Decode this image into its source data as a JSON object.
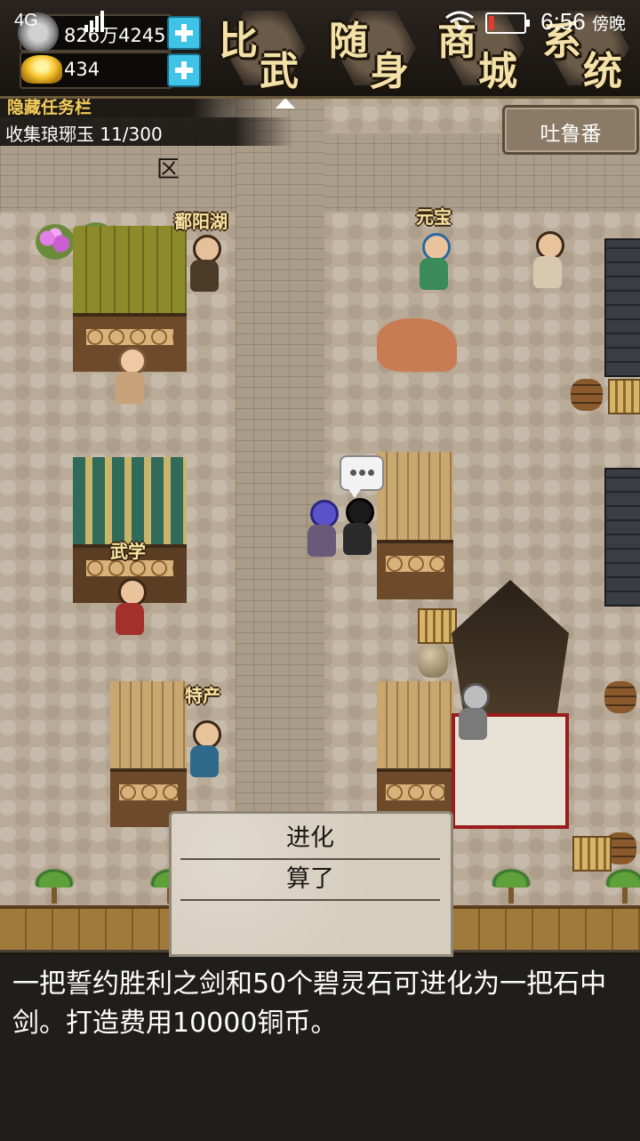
{
  "status_bar": {
    "network": "4G",
    "time": "6:56",
    "period": "傍晚"
  },
  "resources": {
    "copper": "826万4245",
    "ingot": "434"
  },
  "menu": [
    {
      "id": "duel",
      "label": "比武",
      "c1": "比",
      "c2": "武"
    },
    {
      "id": "inventory",
      "label": "随身",
      "c1": "随",
      "c2": "身"
    },
    {
      "id": "shop",
      "label": "商城",
      "c1": "商",
      "c2": "城"
    },
    {
      "id": "system",
      "label": "系统",
      "c1": "系",
      "c2": "统"
    }
  ],
  "quest": {
    "title": "隐藏任务栏",
    "text": "收集琅琊玉 11/300"
  },
  "region": "吐鲁番",
  "map_marker": "区",
  "map_labels": {
    "npc_boyang": "鄱阳湖",
    "npc_yuanbao": "元宝",
    "stall_martial": "武学",
    "npc_specialty": "特产"
  },
  "choices": [
    "进化",
    "算了"
  ],
  "message": "一把誓约胜利之剑和50个碧灵石可进化为一把石中剑。打造费用10000铜币。",
  "colors": {
    "accent_cyan": "#3fc3e6",
    "quest_gold": "#f4cc5a",
    "label_gold": "#f7e2a1"
  }
}
